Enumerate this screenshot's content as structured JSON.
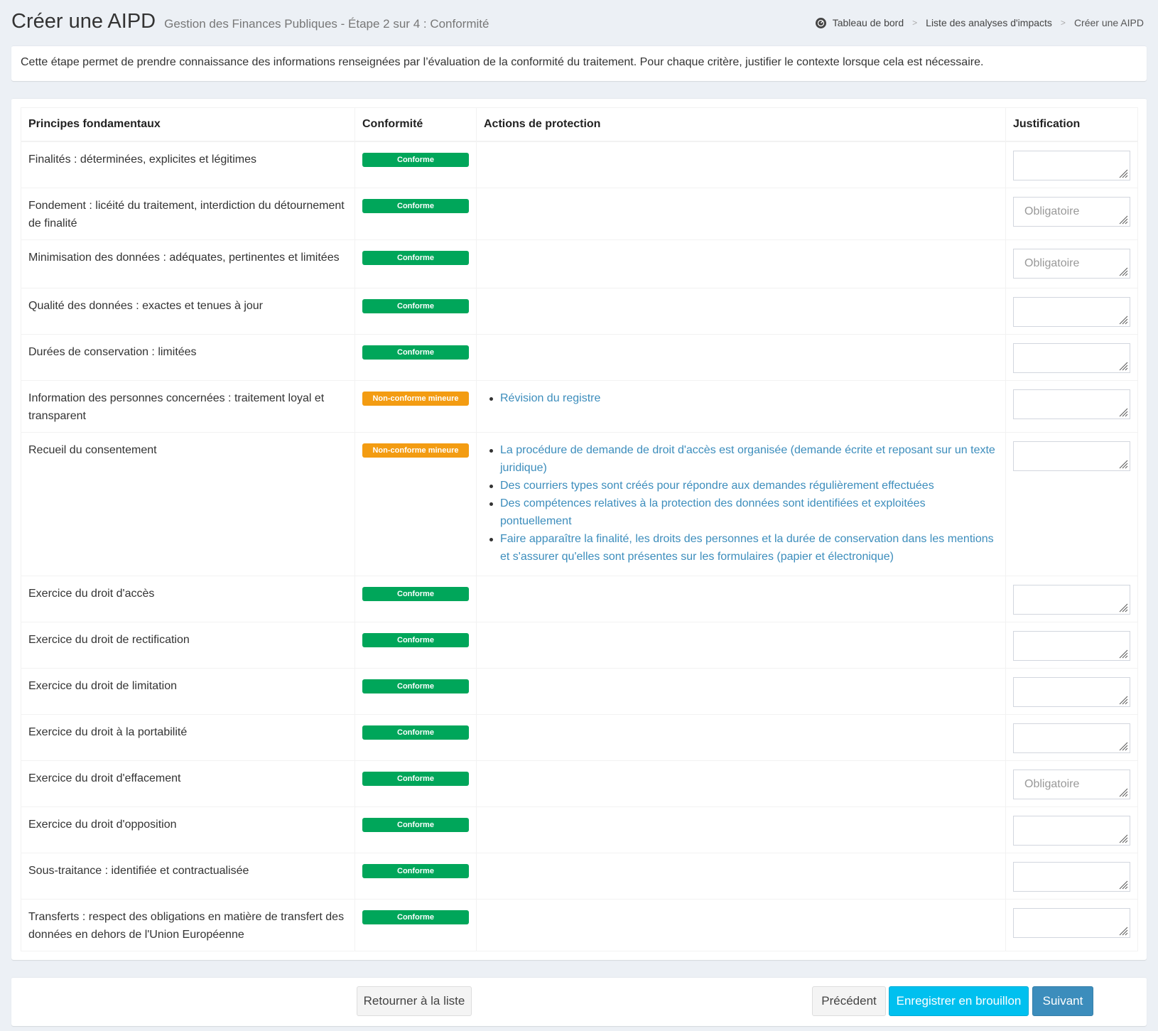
{
  "header": {
    "title": "Créer une AIPD",
    "subtitle": "Gestion des Finances Publiques - Étape 2 sur 4 : Conformité"
  },
  "breadcrumb": {
    "items": [
      "Tableau de bord",
      "Liste des analyses d'impacts",
      "Créer une AIPD"
    ],
    "separator": ">"
  },
  "intro": "Cette étape permet de prendre connaissance des informations renseignées par l’évaluation de la conformité du traitement. Pour chaque critère, justifier le contexte lorsque cela est nécessaire.",
  "table": {
    "headers": [
      "Principes fondamentaux",
      "Conformité",
      "Actions de protection",
      "Justification"
    ],
    "rows": [
      {
        "principle": "Finalités : déterminées, explicites et légitimes",
        "status": "Conforme",
        "actions": [],
        "placeholder": ""
      },
      {
        "principle": "Fondement : licéité du traitement, interdiction du détournement de finalité",
        "status": "Conforme",
        "actions": [],
        "placeholder": "Obligatoire"
      },
      {
        "principle": "Minimisation des données : adéquates, pertinentes et limitées",
        "status": "Conforme",
        "actions": [],
        "placeholder": "Obligatoire"
      },
      {
        "principle": "Qualité des données : exactes et tenues à jour",
        "status": "Conforme",
        "actions": [],
        "placeholder": ""
      },
      {
        "principle": "Durées de conservation : limitées",
        "status": "Conforme",
        "actions": [],
        "placeholder": ""
      },
      {
        "principle": "Information des personnes concernées : traitement loyal et transparent",
        "status": "Non-conforme mineure",
        "actions": [
          "Révision du registre"
        ],
        "placeholder": ""
      },
      {
        "principle": "Recueil du consentement",
        "status": "Non-conforme mineure",
        "actions": [
          "La procédure de demande de droit d'accès est organisée (demande écrite et reposant sur un texte juridique)",
          "Des courriers types sont créés pour répondre aux demandes régulièrement effectuées",
          "Des compétences relatives à la protection des données sont identifiées et exploitées pontuellement",
          "Faire apparaître la finalité, les droits des personnes et la durée de conservation dans les mentions et s'assurer qu'elles sont présentes sur les formulaires (papier et électronique)"
        ],
        "placeholder": ""
      },
      {
        "principle": "Exercice du droit d'accès",
        "status": "Conforme",
        "actions": [],
        "placeholder": ""
      },
      {
        "principle": "Exercice du droit de rectification",
        "status": "Conforme",
        "actions": [],
        "placeholder": ""
      },
      {
        "principle": "Exercice du droit de limitation",
        "status": "Conforme",
        "actions": [],
        "placeholder": ""
      },
      {
        "principle": "Exercice du droit à la portabilité",
        "status": "Conforme",
        "actions": [],
        "placeholder": ""
      },
      {
        "principle": "Exercice du droit d'effacement",
        "status": "Conforme",
        "actions": [],
        "placeholder": "Obligatoire"
      },
      {
        "principle": "Exercice du droit d'opposition",
        "status": "Conforme",
        "actions": [],
        "placeholder": ""
      },
      {
        "principle": "Sous-traitance : identifiée et contractualisée",
        "status": "Conforme",
        "actions": [],
        "placeholder": ""
      },
      {
        "principle": "Transferts : respect des obligations en matière de transfert des données en dehors de l'Union Européenne",
        "status": "Conforme",
        "actions": [],
        "placeholder": ""
      }
    ]
  },
  "footer": {
    "back_label": "Retourner à la liste",
    "prev_label": "Précédent",
    "draft_label": "Enregistrer en brouillon",
    "next_label": "Suivant"
  },
  "colors": {
    "conforme": "#00a65a",
    "non_conforme_mineure": "#f39c12",
    "link": "#3c8dbc",
    "info_button": "#00c0ef",
    "primary_button": "#3c8dbc",
    "background": "#ecf0f5"
  },
  "icons": {
    "breadcrumb_home": "dashboard-icon",
    "textarea_resize": "resize-grip-icon"
  }
}
